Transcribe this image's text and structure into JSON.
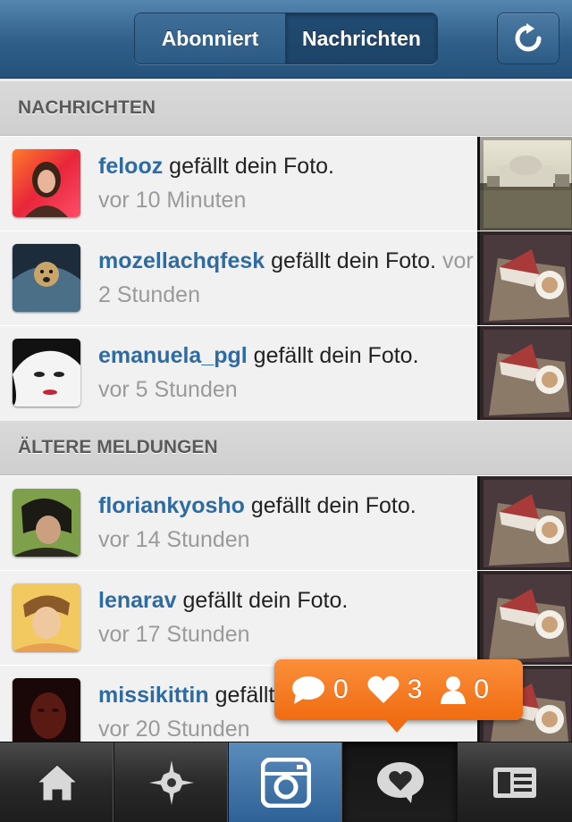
{
  "header": {
    "tabs": [
      {
        "label": "Abonniert",
        "active": false
      },
      {
        "label": "Nachrichten",
        "active": true
      }
    ],
    "refresh_icon": "refresh-icon"
  },
  "sections": {
    "news": "NACHRICHTEN",
    "older": "ÄLTERE MELDUNGEN"
  },
  "rows": [
    {
      "user": "felooz",
      "action": " gefällt dein Foto.",
      "time": "vor 10 Minuten",
      "thumb": "building"
    },
    {
      "user": "mozellachqfesk",
      "action": " gefällt dein Foto.",
      "time": "vor 2 Stunden",
      "thumb": "cake"
    },
    {
      "user": "emanuela_pgl",
      "action": " gefällt dein Foto.",
      "time": "vor 5 Stunden",
      "thumb": "cake"
    },
    {
      "user": "floriankyosho",
      "action": " gefällt dein Foto.",
      "time": "vor 14 Stunden",
      "thumb": "cake"
    },
    {
      "user": "lenarav",
      "action": " gefällt dein Foto.",
      "time": "vor 17 Stunden",
      "thumb": "cake"
    },
    {
      "user": "missikittin",
      "action": " gefällt dein Foto.",
      "time": "vor 20 Stunden",
      "thumb": "cake"
    }
  ],
  "notification": {
    "comments": "0",
    "likes": "3",
    "followers": "0",
    "color": "#f47a22"
  },
  "tabbar": [
    {
      "icon": "home-icon",
      "active": false
    },
    {
      "icon": "explore-star-icon",
      "active": false
    },
    {
      "icon": "camera-icon",
      "active": false
    },
    {
      "icon": "news-heart-bubble-icon",
      "active": true
    },
    {
      "icon": "profile-card-icon",
      "active": false
    }
  ]
}
